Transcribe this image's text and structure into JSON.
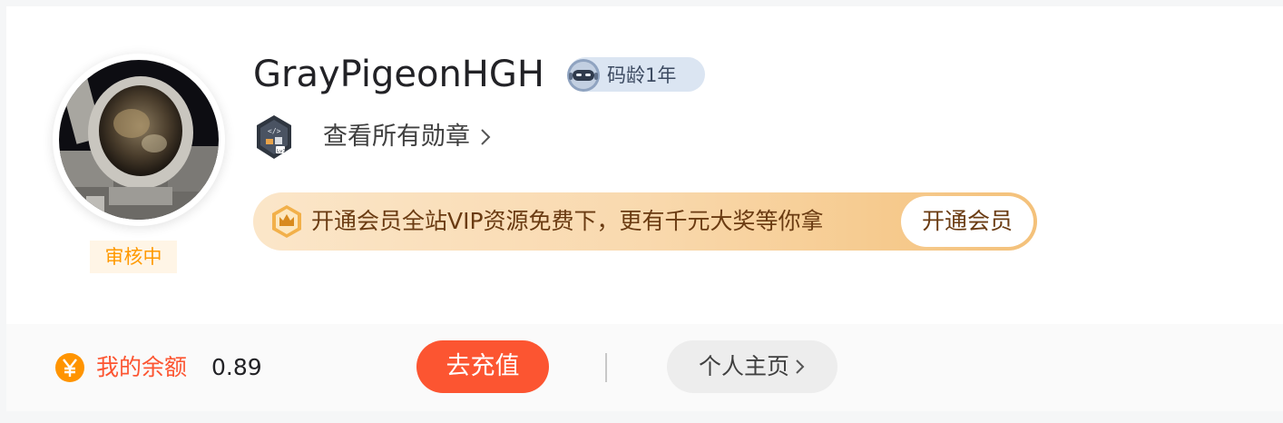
{
  "profile": {
    "username": "GrayPigeonHGH",
    "code_age": "码龄1年",
    "review_status": "审核中",
    "all_badges_link": "查看所有勋章"
  },
  "vip": {
    "promo_text": "开通会员全站VIP资源免费下，更有千元大奖等你拿",
    "button_label": "开通会员"
  },
  "wallet": {
    "balance_label": "我的余额",
    "balance_value": "0.89",
    "recharge_label": "去充值",
    "homepage_label": "个人主页"
  },
  "colors": {
    "accent": "#fc5531",
    "status": "#ff9900",
    "vip_text": "#6a3b12"
  },
  "icons": {
    "robot": "robot-icon",
    "badge": "medal-badge-icon",
    "crown": "crown-icon",
    "yen": "yen-coin-icon",
    "chevron": "chevron-right-icon"
  }
}
